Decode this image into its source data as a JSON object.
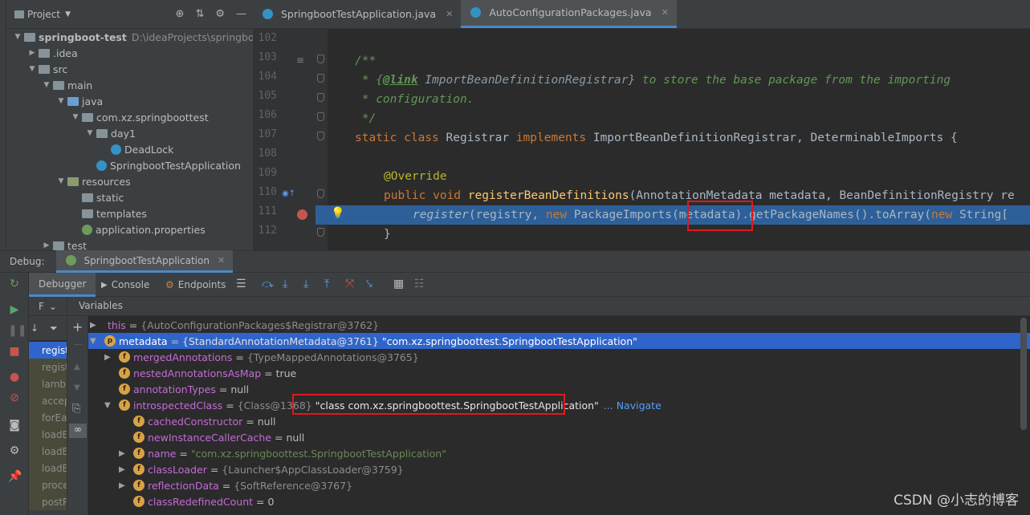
{
  "project": {
    "title": "Project",
    "tree": [
      {
        "label": "springboot-test",
        "path": "D:\\ideaProjects\\springboot-t",
        "indent": 0,
        "icon": "module",
        "expanded": true
      },
      {
        "label": ".idea",
        "indent": 1,
        "icon": "folder",
        "expanded": false
      },
      {
        "label": "src",
        "indent": 1,
        "icon": "folder",
        "expanded": true
      },
      {
        "label": "main",
        "indent": 2,
        "icon": "folder",
        "expanded": true
      },
      {
        "label": "java",
        "indent": 3,
        "icon": "folder-blue",
        "expanded": true
      },
      {
        "label": "com.xz.springboottest",
        "indent": 4,
        "icon": "package",
        "expanded": true
      },
      {
        "label": "day1",
        "indent": 5,
        "icon": "package",
        "expanded": true
      },
      {
        "label": "DeadLock",
        "indent": 6,
        "icon": "class"
      },
      {
        "label": "SpringbootTestApplication",
        "indent": 5,
        "icon": "spring-class"
      },
      {
        "label": "resources",
        "indent": 3,
        "icon": "folder-res",
        "expanded": true
      },
      {
        "label": "static",
        "indent": 4,
        "icon": "folder"
      },
      {
        "label": "templates",
        "indent": 4,
        "icon": "folder"
      },
      {
        "label": "application.properties",
        "indent": 4,
        "icon": "properties"
      },
      {
        "label": "test",
        "indent": 2,
        "icon": "folder",
        "expanded": false
      }
    ]
  },
  "editor": {
    "tabs": [
      {
        "label": "SpringbootTestApplication.java",
        "active": false
      },
      {
        "label": "AutoConfigurationPackages.java",
        "active": true
      }
    ],
    "line_numbers": [
      "102",
      "103",
      "104",
      "105",
      "106",
      "107",
      "108",
      "109",
      "110",
      "111",
      "112"
    ],
    "lines": {
      "l103": "/**",
      "l104a": " * {",
      "l104b": "@link",
      "l104c": " ImportBeanDefinitionRegistrar}",
      "l104d": " to store the base package from the importing",
      "l105": " * configuration.",
      "l106": " */",
      "l107_kw1": "static class ",
      "l107_name": "Registrar ",
      "l107_kw2": "implements ",
      "l107_rest": "ImportBeanDefinitionRegistrar, DeterminableImports {",
      "l109": "@Override",
      "l110_kw": "public void ",
      "l110_fn": "registerBeanDefinitions",
      "l110_rest": "(AnnotationMetadata metadata, BeanDefinitionRegistry re",
      "l111_a": "register",
      "l111_b": "(registry, ",
      "l111_kw": "new ",
      "l111_c": "PackageImports(metadata).getPackageNames().toArray(",
      "l111_kw2": "new ",
      "l111_d": "String[",
      "l112": "}"
    }
  },
  "debug": {
    "label": "Debug:",
    "session": "SpringbootTestApplication",
    "tabs": [
      "Debugger",
      "Console",
      "Endpoints"
    ],
    "frames_filter": "F",
    "variables_title": "Variables",
    "frames": [
      "regist",
      "regist",
      "lamb",
      "accep",
      "forEa",
      "loadE",
      "loadE",
      "loadE",
      "proce",
      "postP"
    ],
    "variables": [
      {
        "indent": 0,
        "expander": "▶",
        "badge": "",
        "name": "this",
        "eq": " = ",
        "type": "{AutoConfigurationPackages$Registrar@3762}",
        "value": ""
      },
      {
        "indent": 0,
        "expander": "▼",
        "badge": "p",
        "name": "metadata",
        "eq": " = ",
        "type": "{StandardAnnotationMetadata@3761}",
        "value": " \"com.xz.springboottest.SpringbootTestApplication\""
      },
      {
        "indent": 1,
        "expander": "▶",
        "badge": "f",
        "name": "mergedAnnotations",
        "eq": " = ",
        "type": "{TypeMappedAnnotations@3765}",
        "value": ""
      },
      {
        "indent": 1,
        "expander": "",
        "badge": "f",
        "name": "nestedAnnotationsAsMap",
        "eq": " = ",
        "type": "",
        "value": "true"
      },
      {
        "indent": 1,
        "expander": "",
        "badge": "f",
        "name": "annotationTypes",
        "eq": " = ",
        "type": "",
        "value": "null"
      },
      {
        "indent": 1,
        "expander": "▼",
        "badge": "f",
        "name": "introspectedClass",
        "eq": " = ",
        "type": "{Class@1368}",
        "value": " \"class com.xz.springboottest.SpringbootTestApplication\"",
        "navigate": "... Navigate"
      },
      {
        "indent": 2,
        "expander": "",
        "badge": "f",
        "name": "cachedConstructor",
        "eq": " = ",
        "type": "",
        "value": "null"
      },
      {
        "indent": 2,
        "expander": "",
        "badge": "f",
        "name": "newInstanceCallerCache",
        "eq": " = ",
        "type": "",
        "value": "null"
      },
      {
        "indent": 2,
        "expander": "▶",
        "badge": "f",
        "name": "name",
        "eq": " = ",
        "type": "",
        "value": "\"com.xz.springboottest.SpringbootTestApplication\""
      },
      {
        "indent": 2,
        "expander": "▶",
        "badge": "f",
        "name": "classLoader",
        "eq": " = ",
        "type": "{Launcher$AppClassLoader@3759}",
        "value": ""
      },
      {
        "indent": 2,
        "expander": "▶",
        "badge": "f",
        "name": "reflectionData",
        "eq": " = ",
        "type": "{SoftReference@3767}",
        "value": ""
      },
      {
        "indent": 2,
        "expander": "",
        "badge": "f",
        "name": "classRedefinedCount",
        "eq": " = ",
        "type": "",
        "value": "0"
      }
    ]
  },
  "watermark": "CSDN @小志的博客"
}
